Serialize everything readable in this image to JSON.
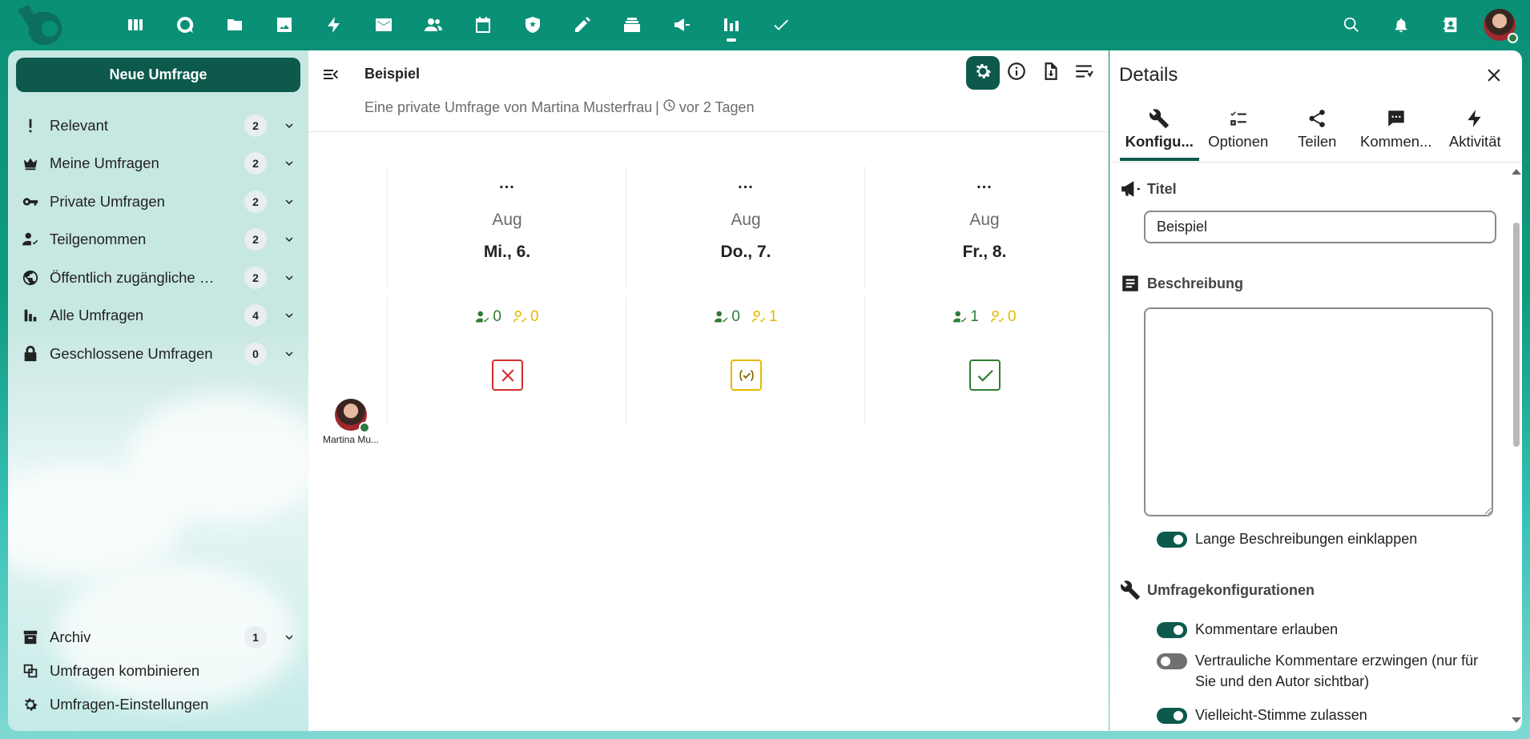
{
  "topbar": {
    "apps": [
      {
        "name": "dashboard-icon"
      },
      {
        "name": "talk-icon"
      },
      {
        "name": "files-icon"
      },
      {
        "name": "photos-icon"
      },
      {
        "name": "activity-icon"
      },
      {
        "name": "mail-icon"
      },
      {
        "name": "contacts-icon"
      },
      {
        "name": "calendar-icon"
      },
      {
        "name": "deck-shield-icon"
      },
      {
        "name": "notes-pencil-icon"
      },
      {
        "name": "archive-stack-icon"
      },
      {
        "name": "announcements-icon"
      },
      {
        "name": "polls-icon",
        "active": true
      },
      {
        "name": "tasks-icon"
      }
    ]
  },
  "sidebar": {
    "new_button": "Neue Umfrage",
    "items": [
      {
        "label": "Relevant",
        "count": "2",
        "icon": "exclamation-icon"
      },
      {
        "label": "Meine Umfragen",
        "count": "2",
        "icon": "crown-icon"
      },
      {
        "label": "Private Umfragen",
        "count": "2",
        "icon": "key-icon"
      },
      {
        "label": "Teilgenommen",
        "count": "2",
        "icon": "account-check-icon"
      },
      {
        "label": "Öffentlich zugängliche …",
        "count": "2",
        "icon": "globe-icon"
      },
      {
        "label": "Alle Umfragen",
        "count": "4",
        "icon": "bar-chart-icon"
      },
      {
        "label": "Geschlossene Umfragen",
        "count": "0",
        "icon": "lock-icon"
      }
    ],
    "archive": {
      "label": "Archiv",
      "count": "1"
    },
    "combine": "Umfragen kombinieren",
    "settings": "Umfragen-Einstellungen"
  },
  "poll": {
    "title": "Beispiel",
    "subtitle": "Eine private Umfrage von Martina Musterfrau",
    "time": "vor 2 Tagen",
    "options": [
      {
        "dots": "...",
        "month": "Aug",
        "day": "Mi., 6.",
        "yes": "0",
        "maybe": "0",
        "vote": "no"
      },
      {
        "dots": "...",
        "month": "Aug",
        "day": "Do., 7.",
        "yes": "0",
        "maybe": "1",
        "vote": "maybe"
      },
      {
        "dots": "...",
        "month": "Aug",
        "day": "Fr., 8.",
        "yes": "1",
        "maybe": "0",
        "vote": "yes"
      }
    ],
    "participant": "Martina Mu..."
  },
  "details": {
    "title": "Details",
    "tabs": [
      "Konfigu...",
      "Optionen",
      "Teilen",
      "Kommen...",
      "Aktivität"
    ],
    "sections": {
      "title_label": "Titel",
      "title_value": "Beispiel",
      "description_label": "Beschreibung",
      "collapse_label": "Lange Beschreibungen einklappen",
      "config_label": "Umfragekonfigurationen",
      "allow_comments": "Kommentare erlauben",
      "confidential_comments": "Vertrauliche Kommentare erzwingen (nur für Sie und den Autor sichtbar)",
      "allow_maybe": "Vielleicht-Stimme zulassen"
    },
    "toggles": {
      "collapse": true,
      "allow_comments": true,
      "confidential_comments": false,
      "allow_maybe": true
    }
  },
  "colors": {
    "primary": "#0d5a4d",
    "header": "#0a8f76",
    "yes": "#2e7d32",
    "maybe": "#e8b900",
    "no": "#d32f2f"
  }
}
